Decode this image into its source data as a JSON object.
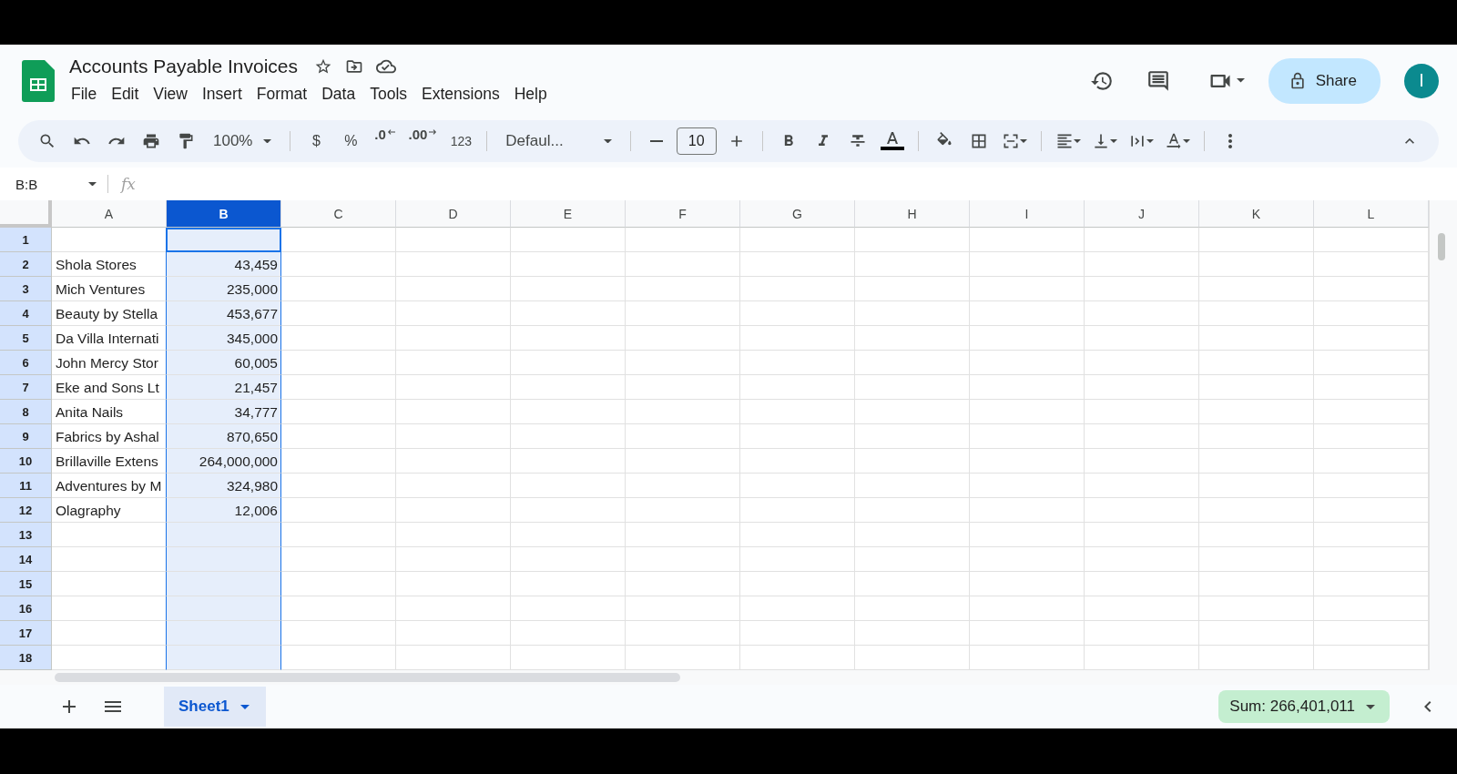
{
  "window": {
    "title": "Accounts Payable Invoices"
  },
  "menu": [
    "File",
    "Edit",
    "View",
    "Insert",
    "Format",
    "Data",
    "Tools",
    "Extensions",
    "Help"
  ],
  "share": {
    "label": "Share"
  },
  "avatar": {
    "initial": "I"
  },
  "toolbar": {
    "zoom": "100%",
    "format_buttons": [
      {
        "label": "$",
        "kind": "plain"
      },
      {
        "label": "%",
        "kind": "plain"
      },
      {
        "label": ".0",
        "kind": "decrease"
      },
      {
        "label": ".00",
        "kind": "increase"
      },
      {
        "label": "123",
        "kind": "small"
      }
    ],
    "font": "Defaul...",
    "font_size": "10"
  },
  "formula_bar": {
    "name_box": "B:B",
    "fx": "fx"
  },
  "grid": {
    "columns": [
      {
        "label": "A",
        "selected": false
      },
      {
        "label": "B",
        "selected": true
      },
      {
        "label": "C",
        "selected": false
      },
      {
        "label": "D",
        "selected": false
      },
      {
        "label": "E",
        "selected": false
      },
      {
        "label": "F",
        "selected": false
      },
      {
        "label": "G",
        "selected": false
      },
      {
        "label": "H",
        "selected": false
      },
      {
        "label": "I",
        "selected": false
      },
      {
        "label": "J",
        "selected": false
      },
      {
        "label": "K",
        "selected": false
      },
      {
        "label": "L",
        "selected": false
      }
    ],
    "rows": [
      {
        "number": "1",
        "active": true
      },
      {
        "number": "2",
        "active": false,
        "name": "Shola Stores",
        "amount": "43,459"
      },
      {
        "number": "3",
        "active": false,
        "name": "Mich Ventures",
        "amount": "235,000"
      },
      {
        "number": "4",
        "active": false,
        "name": "Beauty by Stella",
        "amount": "453,677"
      },
      {
        "number": "5",
        "active": false,
        "name": "Da Villa Internati",
        "amount": "345,000"
      },
      {
        "number": "6",
        "active": false,
        "name": "John Mercy Stor",
        "amount": "60,005"
      },
      {
        "number": "7",
        "active": false,
        "name": "Eke and Sons Lt",
        "amount": "21,457"
      },
      {
        "number": "8",
        "active": false,
        "name": "Anita Nails",
        "amount": "34,777"
      },
      {
        "number": "9",
        "active": false,
        "name": "Fabrics by Ashal",
        "amount": "870,650"
      },
      {
        "number": "10",
        "active": false,
        "name": "Brillaville Extens",
        "amount": "264,000,000"
      },
      {
        "number": "11",
        "active": false,
        "name": "Adventures by M",
        "amount": "324,980"
      },
      {
        "number": "12",
        "active": false,
        "name": "Olagraphy",
        "amount": "12,006"
      },
      {
        "number": "13",
        "active": false
      },
      {
        "number": "14",
        "active": false
      },
      {
        "number": "15",
        "active": false
      },
      {
        "number": "16",
        "active": false
      },
      {
        "number": "17",
        "active": false
      },
      {
        "number": "18",
        "active": false
      }
    ]
  },
  "sheet_tabs": [
    {
      "label": "Sheet1",
      "selected": true
    }
  ],
  "status": {
    "sum": "Sum: 266,401,011"
  }
}
